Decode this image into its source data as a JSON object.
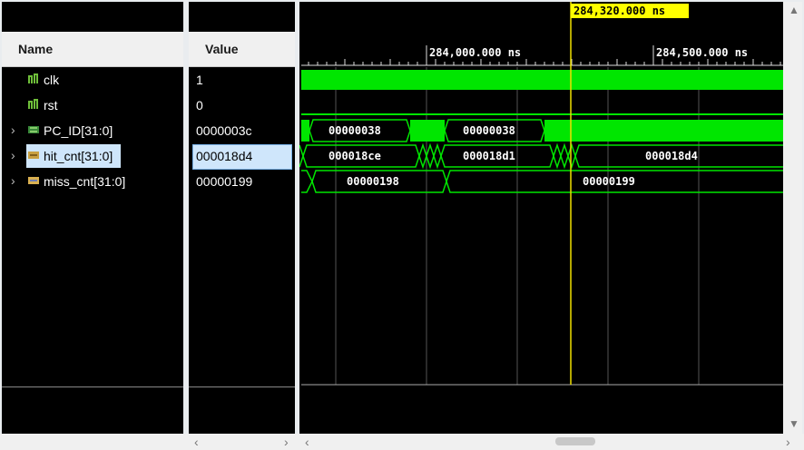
{
  "headers": {
    "name": "Name",
    "value": "Value"
  },
  "signals": [
    {
      "name": "clk",
      "value": "1",
      "type": "bit",
      "expandable": false,
      "selected": false
    },
    {
      "name": "rst",
      "value": "0",
      "type": "bit",
      "expandable": false,
      "selected": false
    },
    {
      "name": "PC_ID[31:0]",
      "value": "0000003c",
      "type": "bus",
      "expandable": true,
      "selected": false
    },
    {
      "name": "hit_cnt[31:0]",
      "value": "000018d4",
      "type": "bus",
      "expandable": true,
      "selected": true
    },
    {
      "name": "miss_cnt[31:0]",
      "value": "00000199",
      "type": "bus",
      "expandable": true,
      "selected": false
    }
  ],
  "waveform": {
    "cursor_label": "284,320.000 ns",
    "time_labels": [
      "284,000.000 ns",
      "284,500.000 ns"
    ],
    "pc_values": [
      "00000038",
      "00000038"
    ],
    "hit_values": [
      "000018ce",
      "000018d1",
      "000018d4"
    ],
    "miss_values": [
      "00000198",
      "00000199"
    ]
  },
  "colors": {
    "wave": "#00e600",
    "cursor": "#f0e000",
    "background": "#000000",
    "cursor_label_bg": "#ffff00"
  }
}
